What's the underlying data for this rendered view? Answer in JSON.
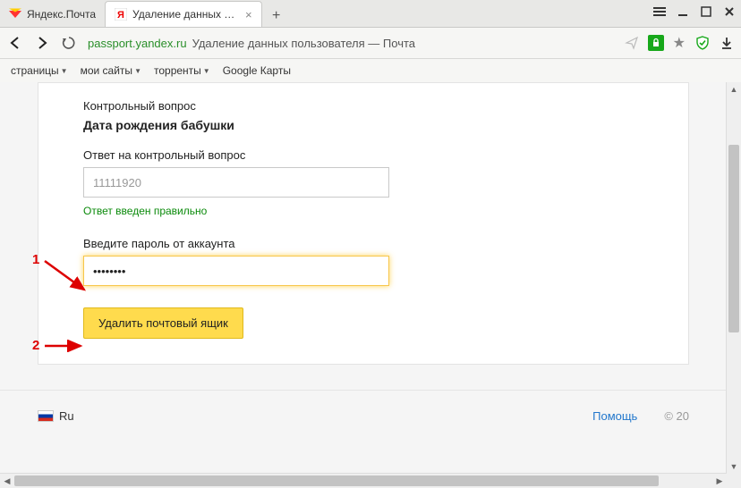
{
  "tabs": {
    "inactive": {
      "label": "Яндекс.Почта"
    },
    "active": {
      "label": "Удаление данных польз"
    }
  },
  "url": {
    "domain": "passport.yandex.ru",
    "rest": "Удаление данных пользователя — Почта"
  },
  "bookmarks": [
    "страницы",
    "мои сайты",
    "торренты",
    "Google Карты"
  ],
  "form": {
    "q_label": "Контрольный вопрос",
    "question": "Дата рождения бабушки",
    "a_label": "Ответ на контрольный вопрос",
    "answer": "11111920",
    "success": "Ответ введен правильно",
    "pw_label": "Введите пароль от аккаунта",
    "pw_value": "••••••••",
    "delete_btn": "Удалить почтовый ящик"
  },
  "footer": {
    "lang": "Ru",
    "help": "Помощь",
    "copy": "© 20"
  },
  "annotations": {
    "one": "1",
    "two": "2"
  }
}
